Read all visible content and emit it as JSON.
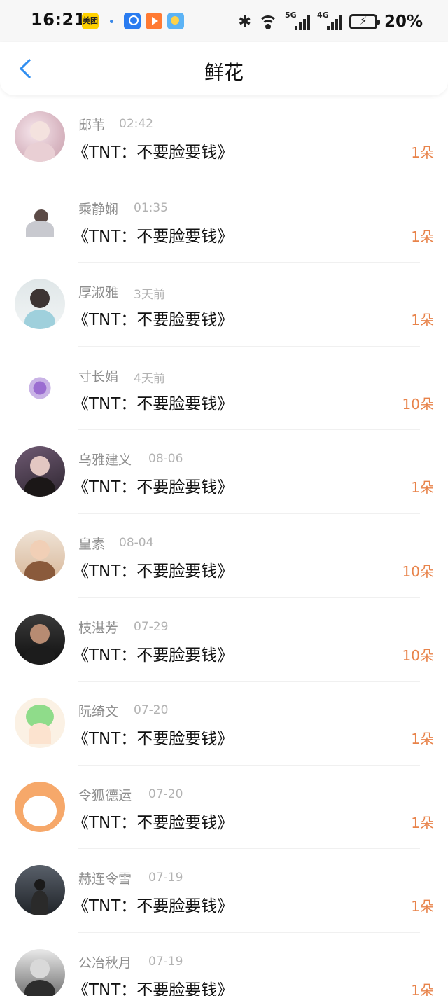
{
  "status_bar": {
    "time": "16:21",
    "apps": [
      "meituan-icon",
      "dot",
      "baidu-netdisk-icon",
      "video-icon",
      "weather-icon"
    ],
    "meituan_label": "美团",
    "network": [
      "5G",
      "4G"
    ],
    "battery": "20%"
  },
  "nav": {
    "title": "鲜花"
  },
  "items": [
    {
      "name": "邸苇",
      "time": "02:42",
      "gift": "《TNT：不要脸要钱》",
      "count": "1朵"
    },
    {
      "name": "乘静娴",
      "time": "01:35",
      "gift": "《TNT：不要脸要钱》",
      "count": "1朵"
    },
    {
      "name": "厚淑雅",
      "time": "3天前",
      "gift": "《TNT：不要脸要钱》",
      "count": "1朵"
    },
    {
      "name": "寸长娟",
      "time": "4天前",
      "gift": "《TNT：不要脸要钱》",
      "count": "10朵"
    },
    {
      "name": "乌雅建义",
      "time": "08-06",
      "gift": "《TNT：不要脸要钱》",
      "count": "1朵"
    },
    {
      "name": "皇素",
      "time": "08-04",
      "gift": "《TNT：不要脸要钱》",
      "count": "10朵"
    },
    {
      "name": "枝湛芳",
      "time": "07-29",
      "gift": "《TNT：不要脸要钱》",
      "count": "10朵"
    },
    {
      "name": "阮绮文",
      "time": "07-20",
      "gift": "《TNT：不要脸要钱》",
      "count": "1朵"
    },
    {
      "name": "令狐德运",
      "time": "07-20",
      "gift": "《TNT：不要脸要钱》",
      "count": "1朵"
    },
    {
      "name": "赫连令雪",
      "time": "07-19",
      "gift": "《TNT：不要脸要钱》",
      "count": "1朵"
    },
    {
      "name": "公冶秋月",
      "time": "07-19",
      "gift": "《TNT：不要脸要钱》",
      "count": "1朵"
    }
  ],
  "colors": {
    "accent": "#2f8ef0",
    "count": "#e8834a",
    "name": "#8e8e8e",
    "time": "#b2b2b2"
  }
}
